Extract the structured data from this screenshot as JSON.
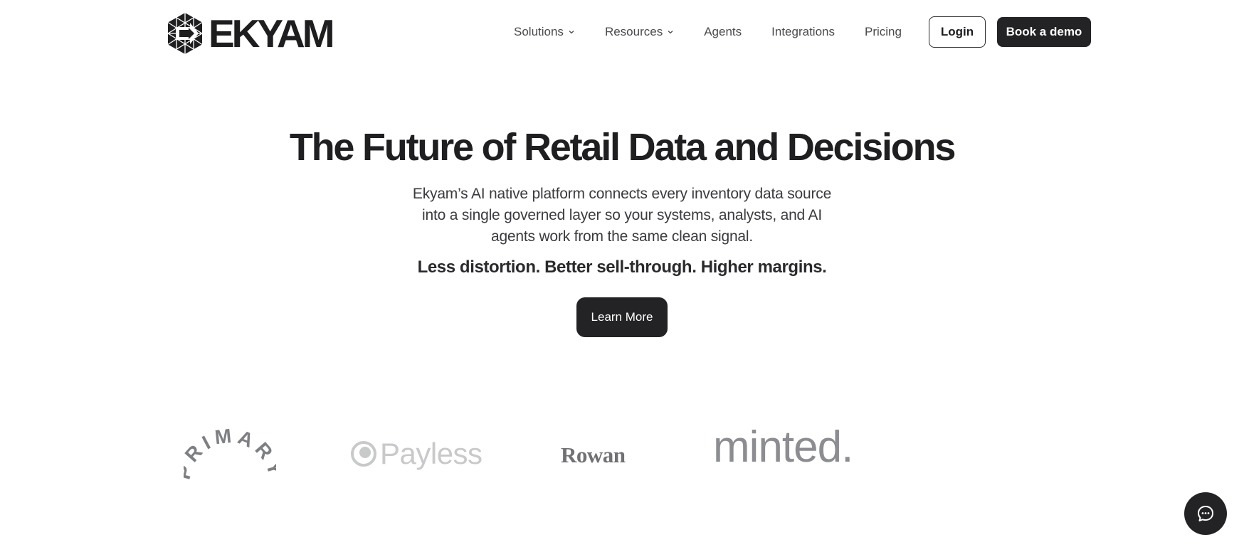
{
  "brand": {
    "name": "EKYAM"
  },
  "nav": {
    "items": [
      {
        "label": "Solutions",
        "dropdown": true
      },
      {
        "label": "Resources",
        "dropdown": true
      },
      {
        "label": "Agents",
        "dropdown": false
      },
      {
        "label": "Integrations",
        "dropdown": false
      },
      {
        "label": "Pricing",
        "dropdown": false
      }
    ],
    "login_label": "Login",
    "demo_label": "Book a demo"
  },
  "hero": {
    "title": "The Future of Retail Data and Decisions",
    "description": "Ekyam’s AI native platform connects every inventory data source into a single governed layer so your systems, analysts, and AI agents work from the same clean signal.",
    "tagline": "Less distortion. Better sell-through. Higher margins.",
    "cta_label": "Learn More"
  },
  "clients": {
    "primary": "PRIMARY",
    "payless": "Payless",
    "rowan": "Rowan",
    "minted": "minted."
  },
  "colors": {
    "text_dark": "#1f1f22",
    "button_dark": "#232326",
    "nav_text": "#4a4a4e",
    "logo_gray": "#8b8d90"
  },
  "icons": {
    "chevron": "chevron-down-icon",
    "chat": "chat-bubble-icon"
  }
}
